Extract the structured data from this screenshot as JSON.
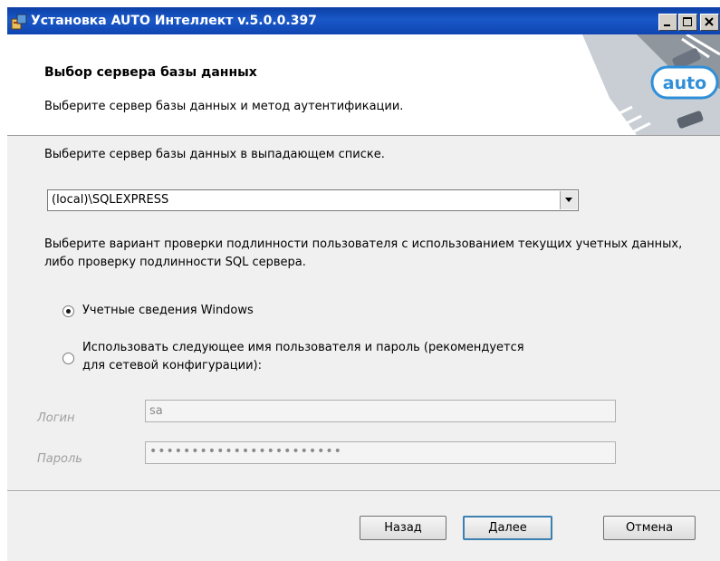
{
  "window": {
    "title": "Установка AUTO Интеллект v.5.0.0.397"
  },
  "header": {
    "title": "Выбор сервера базы данных",
    "subtitle": "Выберите сервер базы данных и метод аутентификации.",
    "logo_text": "auto"
  },
  "server": {
    "prompt": "Выберите сервер базы данных в выпадающем списке.",
    "selected": "(local)\\SQLEXPRESS"
  },
  "auth": {
    "prompt": "Выберите вариант проверки подлинности пользователя с использованием текущих учетных данных, либо проверку подлинности SQL сервера.",
    "option_windows": "Учетные сведения Windows",
    "option_sql_line1": "Использовать следующее имя пользователя и пароль (рекомендуется",
    "option_sql_line2": "для сетевой конфигурации):",
    "selected": "windows"
  },
  "login": {
    "label": "Логин",
    "value": "sa"
  },
  "password": {
    "label": "Пароль",
    "value": "•••••••••••••••••••••••"
  },
  "buttons": {
    "back": "Назад",
    "next": "Далее",
    "cancel": "Отмена"
  },
  "icons": {
    "app": "installer-icon",
    "minimize": "minimize-icon",
    "maximize": "maximize-icon",
    "close": "close-icon",
    "dropdown": "chevron-down-icon"
  },
  "colors": {
    "titlebar": "#1a58c8",
    "logo": "#2f8fd8"
  }
}
